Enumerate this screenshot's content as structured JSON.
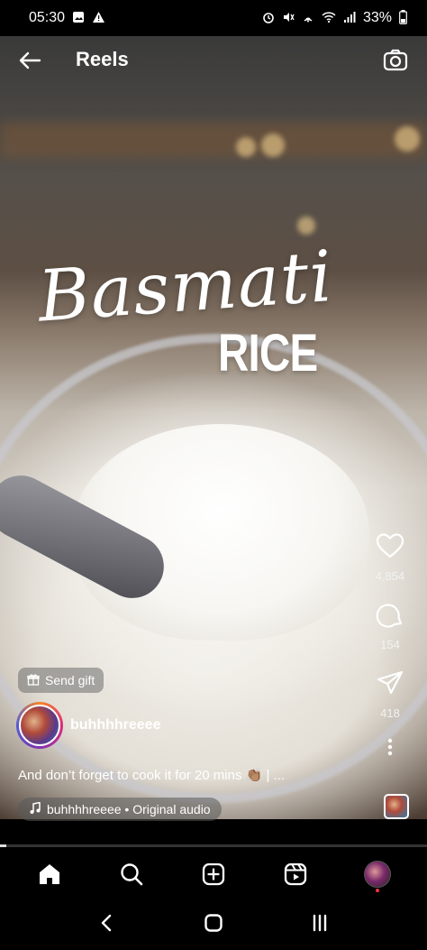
{
  "status_bar": {
    "time": "05:30",
    "battery": "33%",
    "left_icons": [
      "image-icon",
      "warning-icon"
    ],
    "right_icons": [
      "alarm-icon",
      "mute-icon",
      "nfc-icon",
      "wifi-icon",
      "signal-icon",
      "battery-icon"
    ]
  },
  "header": {
    "title": "Reels",
    "back_icon": "back-arrow-icon",
    "camera_icon": "camera-icon"
  },
  "video": {
    "overlay_script_text": "Basmati",
    "overlay_block_text": "RICE",
    "progress_fraction": 0.015
  },
  "actions": {
    "likes": "4,854",
    "comments": "154",
    "shares": "418"
  },
  "post": {
    "send_gift_label": "Send gift",
    "username": "buhhhhreeee",
    "caption": "And don’t forget to cook it for 20 mins 👏🏽 | ...",
    "audio_label": "buhhhhreeee • Original audio"
  },
  "bottom_nav": {
    "items": [
      "home-icon",
      "search-icon",
      "create-icon",
      "reels-icon",
      "profile-avatar"
    ]
  },
  "system_nav": {
    "items": [
      "back-icon",
      "home-icon",
      "recents-icon"
    ]
  }
}
